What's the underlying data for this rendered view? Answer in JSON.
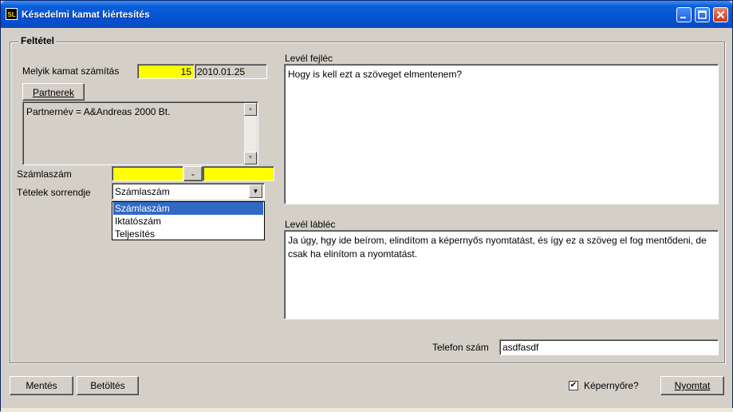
{
  "window": {
    "title": "Késedelmi kamat kiértesítés",
    "icon": "app-icon",
    "icon_text": "SL"
  },
  "group": {
    "label": "Feltétel"
  },
  "interest": {
    "label": "Melyik kamat számítás",
    "value": "15",
    "date": "2010.01.25"
  },
  "partners": {
    "button_label": "Partnerek",
    "memo_text": "Partnernév = A&Andreas 2000 Bt."
  },
  "invoice": {
    "label": "Számlaszám",
    "from_value": "",
    "separator": "-",
    "to_value": ""
  },
  "order": {
    "label": "Tételek sorrendje",
    "selected": "Számlaszám",
    "options": [
      "Számlaszám",
      "Iktatószám",
      "Teljesítés"
    ]
  },
  "header": {
    "label": "Levél fejléc",
    "text": "Hogy is kell ezt a szöveget elmentenem?"
  },
  "footer": {
    "label": "Levél lábléc",
    "text": "Ja úgy, hgy ide beírom, elindítom a képernyős nyomtatást, és így ez a szöveg el fog mentődeni, de csak ha elinítom a nyomtatást."
  },
  "phone": {
    "label": "Telefon szám",
    "value": "asdfasdf"
  },
  "buttons": {
    "save": "Mentés",
    "load": "Betöltés",
    "screen_checkbox_label": "Képernyőre?",
    "screen_checked": true,
    "print": "Nyomtat"
  },
  "colors": {
    "title_blue": "#0553d6",
    "highlight_yellow": "#ffff00",
    "selection_blue": "#316ac5"
  }
}
